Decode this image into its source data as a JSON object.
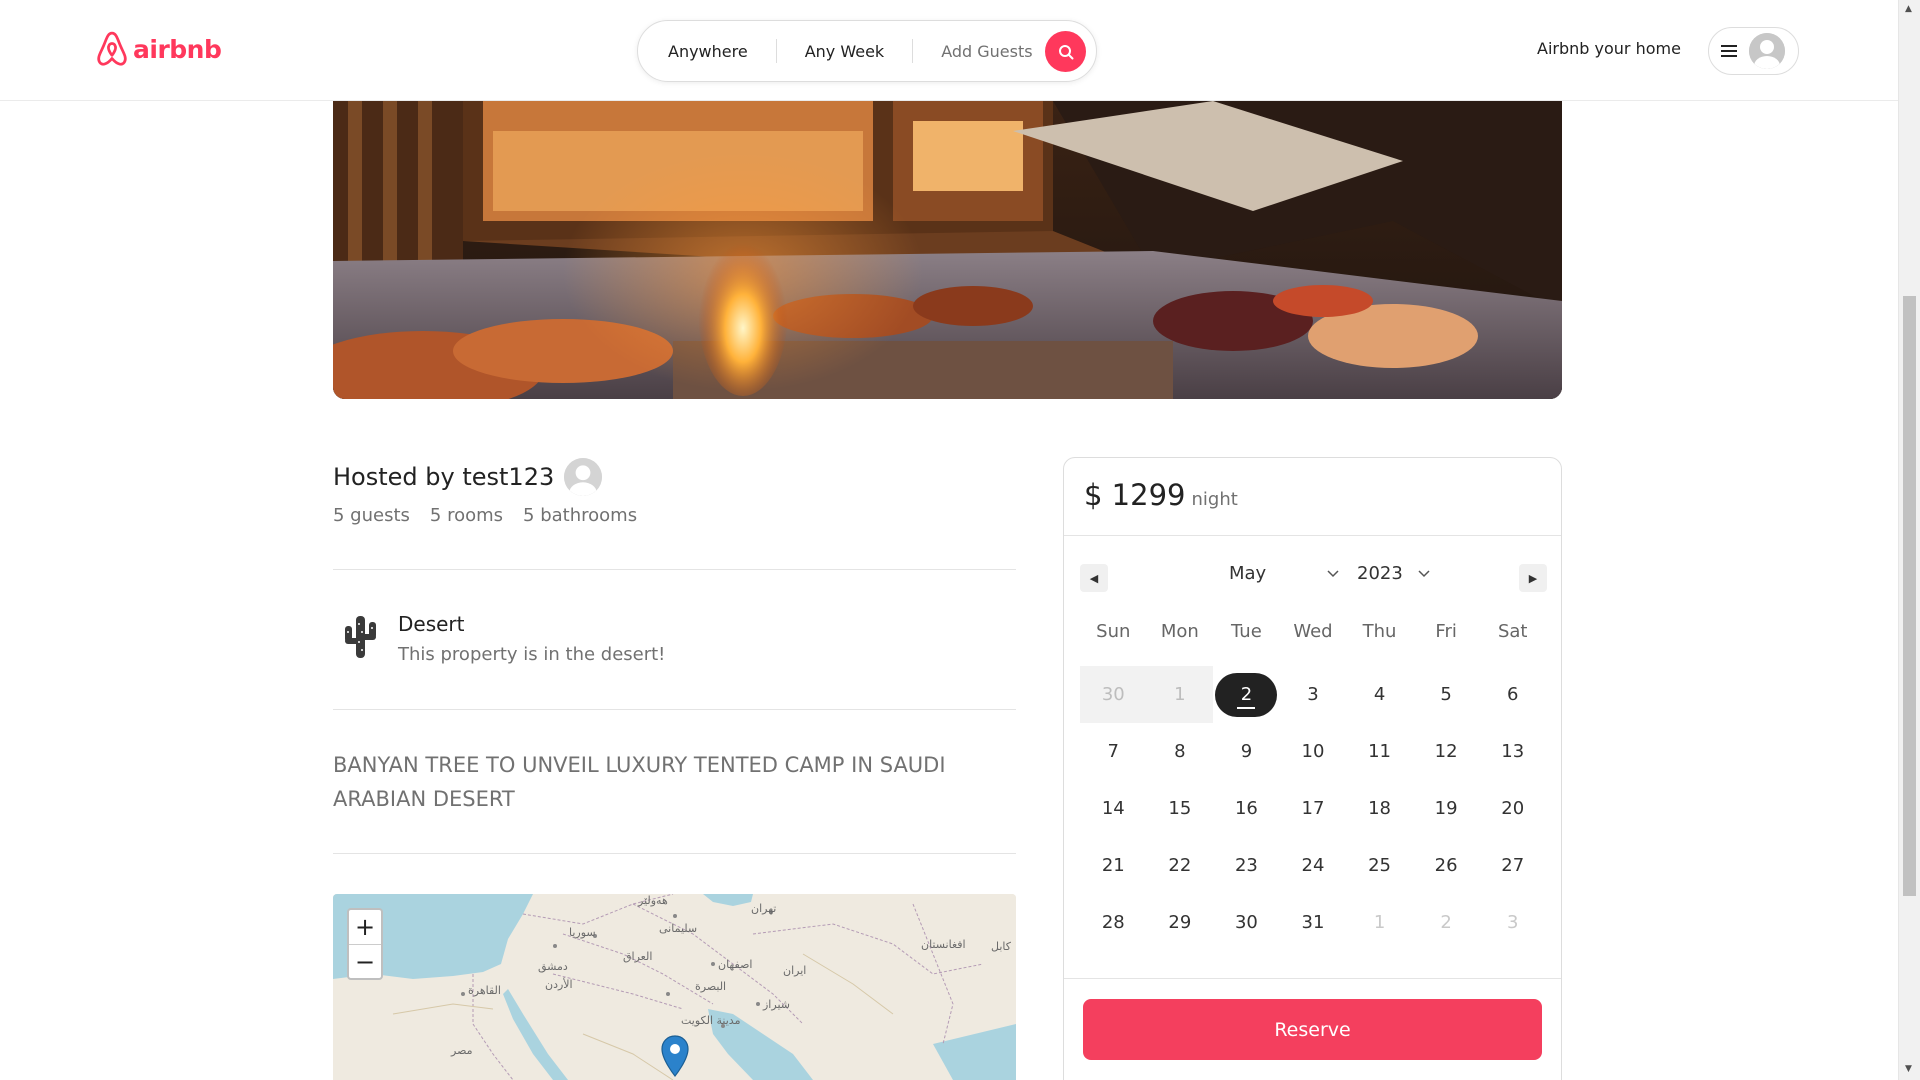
{
  "header": {
    "logo_text": "airbnb",
    "search": {
      "location": "Anywhere",
      "week": "Any Week",
      "guests": "Add Guests"
    },
    "host_link": "Airbnb your home"
  },
  "listing": {
    "host_title": "Hosted by test123",
    "stats": {
      "guests": "5 guests",
      "rooms": "5 rooms",
      "bathrooms": "5 bathrooms"
    },
    "feature": {
      "title": "Desert",
      "description": "This property is in the desert!"
    },
    "description": "BANYAN TREE TO UNVEIL LUXURY TENTED CAMP IN SAUDI ARABIAN DESERT"
  },
  "map": {
    "zoom_in": "+",
    "zoom_out": "−",
    "labels": [
      "هەولێر",
      "تهران",
      "سوريا",
      "سليمانى",
      "العراق",
      "دمشق",
      "الأردن",
      "القاهرة",
      "اصفهان",
      "ایران",
      "البصرة",
      "شیراز",
      "مدينة الكويت",
      "مصر",
      "افغانستان",
      "کابل"
    ]
  },
  "booking": {
    "price": "$ 1299",
    "price_unit": "night",
    "month": "May",
    "year": "2023",
    "weekdays": [
      "Sun",
      "Mon",
      "Tue",
      "Wed",
      "Thu",
      "Fri",
      "Sat"
    ],
    "days": [
      {
        "d": "30",
        "s": "disabled"
      },
      {
        "d": "1",
        "s": "disabled"
      },
      {
        "d": "2",
        "s": "selected"
      },
      {
        "d": "3",
        "s": ""
      },
      {
        "d": "4",
        "s": ""
      },
      {
        "d": "5",
        "s": ""
      },
      {
        "d": "6",
        "s": ""
      },
      {
        "d": "7",
        "s": ""
      },
      {
        "d": "8",
        "s": ""
      },
      {
        "d": "9",
        "s": ""
      },
      {
        "d": "10",
        "s": ""
      },
      {
        "d": "11",
        "s": ""
      },
      {
        "d": "12",
        "s": ""
      },
      {
        "d": "13",
        "s": ""
      },
      {
        "d": "14",
        "s": ""
      },
      {
        "d": "15",
        "s": ""
      },
      {
        "d": "16",
        "s": ""
      },
      {
        "d": "17",
        "s": ""
      },
      {
        "d": "18",
        "s": ""
      },
      {
        "d": "19",
        "s": ""
      },
      {
        "d": "20",
        "s": ""
      },
      {
        "d": "21",
        "s": ""
      },
      {
        "d": "22",
        "s": ""
      },
      {
        "d": "23",
        "s": ""
      },
      {
        "d": "24",
        "s": ""
      },
      {
        "d": "25",
        "s": ""
      },
      {
        "d": "26",
        "s": ""
      },
      {
        "d": "27",
        "s": ""
      },
      {
        "d": "28",
        "s": ""
      },
      {
        "d": "29",
        "s": ""
      },
      {
        "d": "30",
        "s": ""
      },
      {
        "d": "31",
        "s": ""
      },
      {
        "d": "1",
        "s": "other"
      },
      {
        "d": "2",
        "s": "other"
      },
      {
        "d": "3",
        "s": "other"
      }
    ],
    "reserve_label": "Reserve"
  },
  "colors": {
    "brand": "#ff385c",
    "reserve": "#f43f5e",
    "text": "#222222",
    "muted": "#717171"
  }
}
